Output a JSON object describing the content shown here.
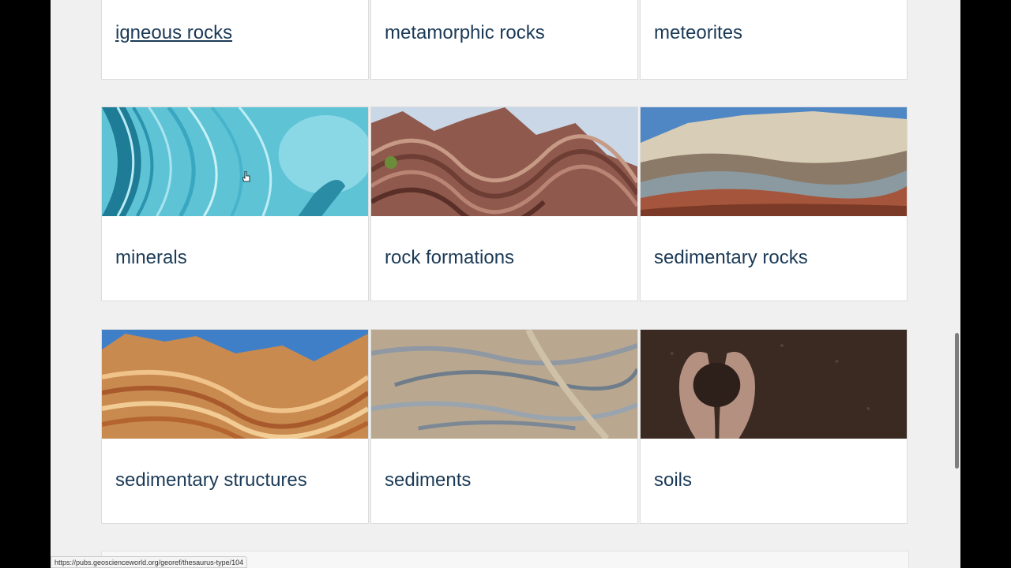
{
  "categories": [
    {
      "label": "igneous rocks",
      "name": "card-igneous-rocks",
      "image": "none",
      "hovered": true
    },
    {
      "label": "metamorphic rocks",
      "name": "card-metamorphic-rocks",
      "image": "none"
    },
    {
      "label": "meteorites",
      "name": "card-meteorites",
      "image": "none"
    },
    {
      "label": "minerals",
      "name": "card-minerals",
      "image": "blue-agate-photo"
    },
    {
      "label": "rock formations",
      "name": "card-rock-formations",
      "image": "folded-rock-strata-photo"
    },
    {
      "label": "sedimentary rocks",
      "name": "card-sedimentary-rocks",
      "image": "eroded-cliff-layers-photo"
    },
    {
      "label": "sedimentary structures",
      "name": "card-sedimentary-structures",
      "image": "sandstone-wave-photo"
    },
    {
      "label": "sediments",
      "name": "card-sediments",
      "image": "sand-ripples-photo"
    },
    {
      "label": "soils",
      "name": "card-soils",
      "image": "hands-holding-soil-photo"
    }
  ],
  "status_bar": {
    "url": "https://pubs.geoscienceworld.org/georef/thesaurus-type/104"
  },
  "colors": {
    "link_text": "#1b3a57",
    "page_background": "#f0f0f0",
    "card_background": "#ffffff"
  }
}
